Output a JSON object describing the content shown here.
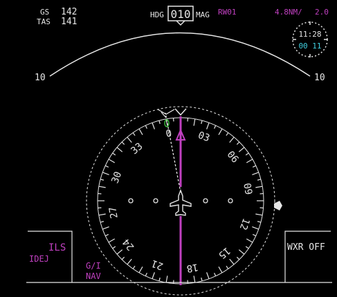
{
  "speeds": {
    "gs_label": "GS",
    "gs_value": "142",
    "tas_label": "TAS",
    "tas_value": "141"
  },
  "heading": {
    "hdg_label": "HDG",
    "value": "010",
    "mag_label": "MAG"
  },
  "waypoint": {
    "name": "RW01",
    "distance": "4.8NM/",
    "time": "2.0"
  },
  "clock": {
    "time": "11:28",
    "elapsed": "00 11"
  },
  "range_ring": {
    "left_label": "10",
    "right_label": "10"
  },
  "compass_labels": [
    "0",
    "03",
    "06",
    "09",
    "12",
    "15",
    "18",
    "21",
    "24",
    "27",
    "30",
    "33"
  ],
  "bearing": {
    "bearing_deg": -15,
    "course_deg": 0
  },
  "left_box": {
    "mode": "ILS",
    "ident": "IDEJ"
  },
  "nav_source": {
    "line1": "G/I",
    "line2": "NAV"
  },
  "weather": {
    "status": "WXR OFF"
  },
  "colors": {
    "magenta": "#c040c0",
    "white": "#e6e6e6",
    "cyan": "#40d0e0",
    "green": "#40c040",
    "background": "#000000"
  },
  "icons": [
    "aircraft-symbol-icon",
    "heading-bug-icon",
    "bearing-pointer-icon",
    "clock-icon",
    "wind-arrow-icon"
  ]
}
